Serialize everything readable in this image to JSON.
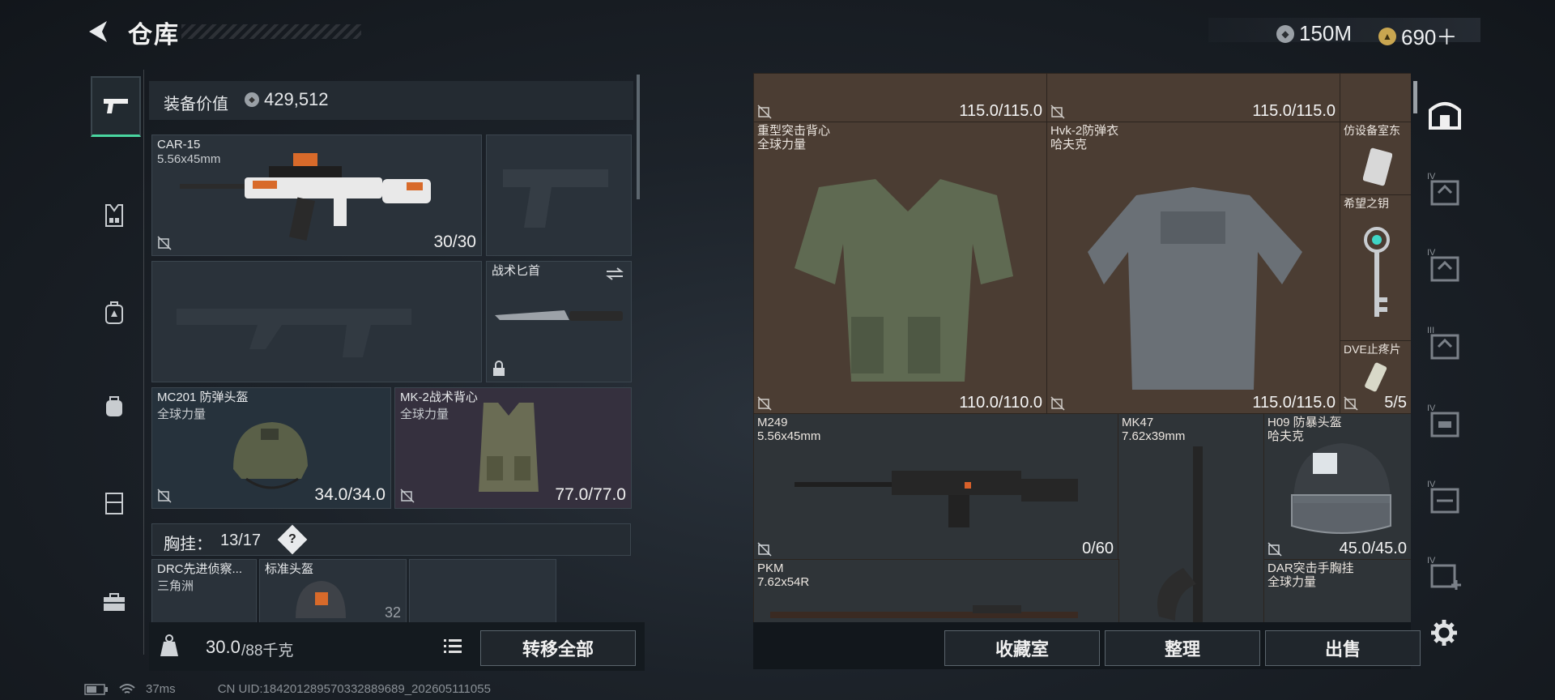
{
  "header": {
    "title": "仓库",
    "currency": [
      {
        "icon": "silver-coin-icon",
        "value": "150M"
      },
      {
        "icon": "gold-coin-icon",
        "value": "690＋"
      }
    ]
  },
  "left_nav": {
    "items": [
      {
        "icon": "pistol-icon",
        "active": true
      },
      {
        "icon": "vest-icon"
      },
      {
        "icon": "backpack-icon"
      },
      {
        "icon": "bag-icon"
      },
      {
        "icon": "locker-icon"
      },
      {
        "icon": "toolbox-icon"
      }
    ]
  },
  "equipment": {
    "value_label": "装备价值",
    "value": "429,512",
    "primary": {
      "name": "CAR-15",
      "caliber": "5.56x45mm",
      "ammo": "30/30"
    },
    "knife": {
      "name": "战术匕首"
    },
    "helmet": {
      "name": "MC201 防弹头盔",
      "faction": "全球力量",
      "durability": "34.0/34.0"
    },
    "vest": {
      "name": "MK-2战术背心",
      "faction": "全球力量",
      "durability": "77.0/77.0"
    },
    "chest_rig": {
      "label": "胸挂：",
      "count": "13/17",
      "help": "?"
    },
    "rig_items": [
      {
        "name": "DRC先进侦察...",
        "faction": "三角洲"
      },
      {
        "name": "标准头盔",
        "value": "32"
      }
    ],
    "weight": {
      "value": "30.0",
      "max": "/88千克"
    },
    "transfer_all": "转移全部"
  },
  "storage": {
    "cells": [
      {
        "value": "115.0/115.0"
      },
      {
        "value": "115.0/115.0"
      },
      {
        "name": "重型突击背心",
        "faction": "全球力量",
        "value": "110.0/110.0"
      },
      {
        "name": "Hvk-2防弹衣",
        "faction": "哈夫克",
        "value": "115.0/115.0"
      },
      {
        "name": "仿设备室东"
      },
      {
        "name": "希望之钥"
      },
      {
        "name": "DVE止疼片",
        "value": "5/5"
      },
      {
        "name": "M249",
        "caliber": "5.56x45mm",
        "value": "0/60"
      },
      {
        "name": "MK47",
        "caliber": "7.62x39mm"
      },
      {
        "name": "H09 防暴头盔",
        "faction": "哈夫克",
        "value": "45.0/45.0"
      },
      {
        "name": "PKM",
        "caliber": "7.62x54R"
      },
      {
        "name": "DAR突击手胸挂",
        "faction": "全球力量"
      }
    ],
    "buttons": {
      "collection": "收藏室",
      "sort": "整理",
      "sell": "出售"
    }
  },
  "right_nav": {
    "tiers": [
      "IV",
      "IV",
      "III",
      "IV",
      "IV",
      "IV"
    ],
    "settings_icon": "gear-icon"
  },
  "status": {
    "ping": "37ms",
    "uid": "CN UID:1842012895703328896​89_202605111055"
  }
}
